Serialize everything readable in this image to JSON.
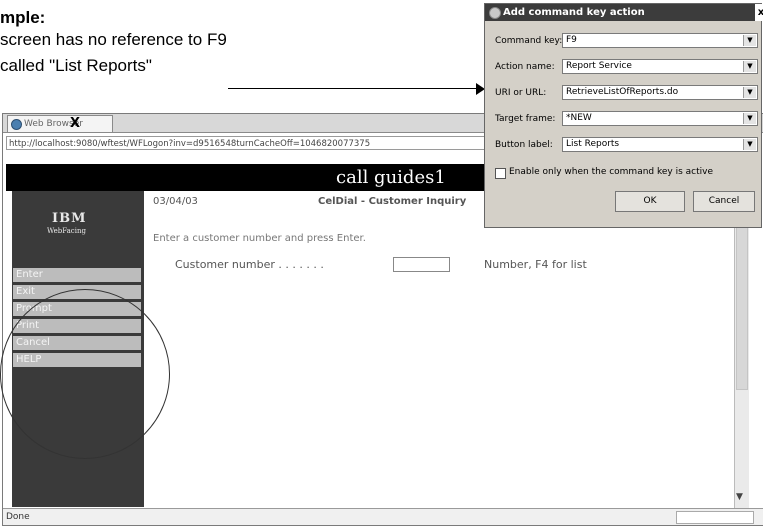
{
  "annotation": {
    "title": "mple:",
    "line1": "screen has no reference to F9",
    "line2": "called \"List Reports\""
  },
  "browser": {
    "tab_label": "Web Browser",
    "tab_close": "X",
    "address": "http://localhost:9080/wftest/WFLogon?inv=d9516548turnCacheOff=1046820077375",
    "header_title": "call guides1",
    "logo": "IBM",
    "logo_sub": "WebFacing",
    "date": "03/04/03",
    "screen_title": "CelDial - Customer Inquiry",
    "instruction": "Enter a customer number and press Enter.",
    "customer_label": "Customer number . . . . . . .",
    "customer_value": "",
    "customer_hint": "Number, F4 for list",
    "status": "Done",
    "menu": [
      "Enter",
      "Exit",
      "Prompt",
      "Print",
      "Cancel",
      "HELP"
    ]
  },
  "dialog": {
    "title": "Add command key action",
    "close": "x",
    "fields": [
      {
        "label": "Command key:",
        "value": "F9"
      },
      {
        "label": "Action name:",
        "value": "Report Service"
      },
      {
        "label": "URI or URL:",
        "value": "RetrieveListOfReports.do"
      },
      {
        "label": "Target frame:",
        "value": "*NEW"
      },
      {
        "label": "Button label:",
        "value": "List Reports"
      }
    ],
    "checkbox_label": "Enable only when the command key is active",
    "checkbox_checked": false,
    "ok": "OK",
    "cancel": "Cancel"
  }
}
